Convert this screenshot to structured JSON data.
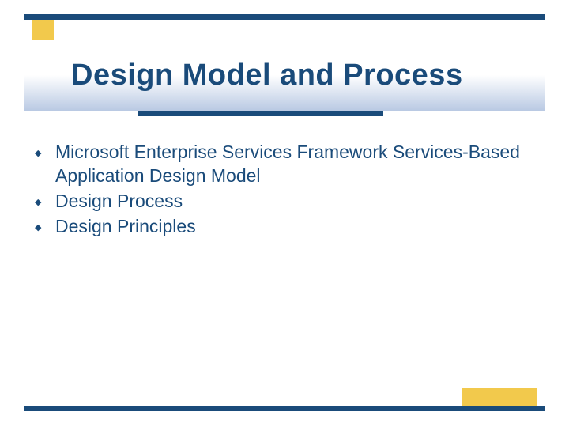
{
  "title": "Design Model and Process",
  "bullets": [
    "Microsoft Enterprise Services Framework Services-Based Application Design Model",
    "Design Process",
    "Design Principles"
  ]
}
